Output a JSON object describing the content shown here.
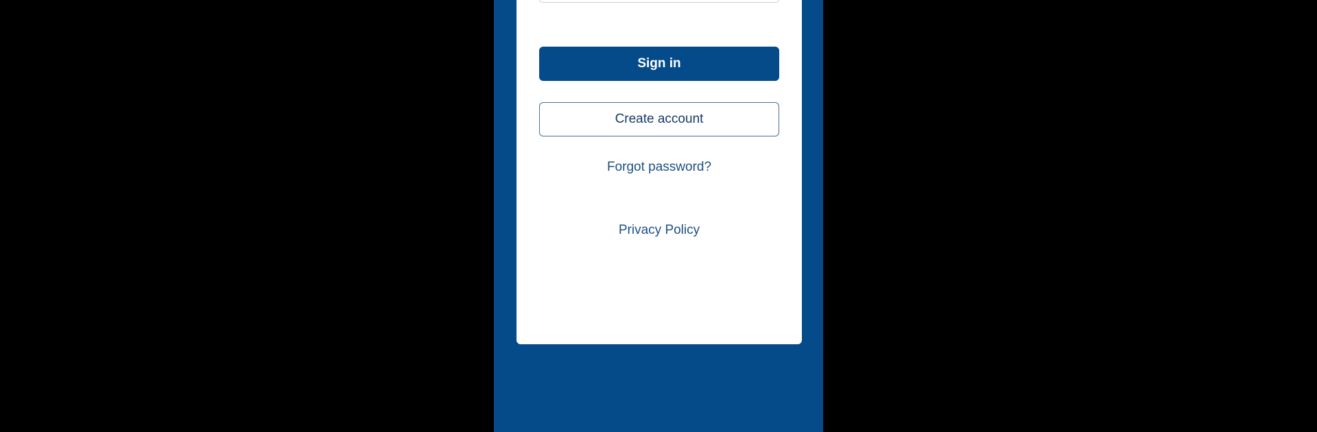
{
  "login": {
    "password_mask": "••••••••",
    "sign_in_label": "Sign in",
    "create_account_label": "Create account",
    "forgot_password_label": "Forgot password?",
    "privacy_policy_label": "Privacy Policy"
  },
  "icons": {
    "password_toggle": "eye-slash-icon"
  },
  "colors": {
    "brand_blue": "#054b8a",
    "background": "#000000",
    "card": "#ffffff",
    "link": "#1d4f86"
  }
}
